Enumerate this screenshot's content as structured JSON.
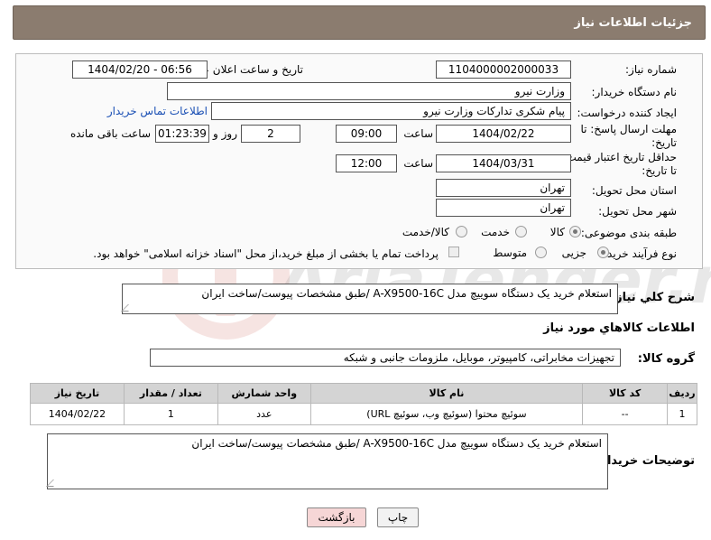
{
  "header": {
    "title": "جزئیات اطلاعات نیاز"
  },
  "form": {
    "need_number_label": "شماره نیاز:",
    "need_number": "1104000002000033",
    "announce_label": "تاریخ و ساعت اعلان عمومی:",
    "announce_value": "1404/02/20 - 06:56",
    "buyer_org_label": "نام دستگاه خریدار:",
    "buyer_org": "وزارت نیرو",
    "requester_label": "ایجاد کننده درخواست:",
    "requester": "پیام شکری تدارکات وزارت نیرو",
    "contact_link": "اطلاعات تماس خریدار",
    "reply_deadline_label": "مهلت ارسال پاسخ: تا تاریخ:",
    "reply_date": "1404/02/22",
    "time_label": "ساعت",
    "reply_time": "09:00",
    "days_value": "2",
    "days_label": "روز و",
    "remaining_time": "01:23:39",
    "remaining_label": "ساعت باقی مانده",
    "validity_label": "حداقل تاریخ اعتبار قیمت: تا تاریخ:",
    "validity_date": "1404/03/31",
    "validity_time": "12:00",
    "province_label": "استان محل تحویل:",
    "province": "تهران",
    "city_label": "شهر محل تحویل:",
    "city": "تهران",
    "category_label": "طبقه بندی موضوعی:",
    "category_options": [
      "کالا",
      "خدمت",
      "کالا/خدمت"
    ],
    "process_label": "نوع فرآیند خرید :",
    "process_options": [
      "جزیی",
      "متوسط"
    ],
    "payment_note": "پرداخت تمام یا بخشی از مبلغ خرید،از محل \"اسناد خزانه اسلامی\" خواهد بود."
  },
  "summary": {
    "label": "شرح کلي نياز:",
    "text": "استعلام خرید یک دستگاه سوییچ مدل A-X9500-16C /طبق مشخصات پیوست/ساخت ایران"
  },
  "goods_section": {
    "title": "اطلاعات کالاهاي مورد نياز",
    "group_label": "گروه کالا:",
    "group_value": "تجهیزات مخابراتی، کامپیوتر، موبایل، ملزومات جانبی و شبکه"
  },
  "table": {
    "headers": [
      "ردیف",
      "کد کالا",
      "نام کالا",
      "واحد شمارش",
      "تعداد / مقدار",
      "تاریخ نیاز"
    ],
    "rows": [
      [
        "1",
        "--",
        "سوئیچ محتوا (سوئیچ وب، سوئیچ URL)",
        "عدد",
        "1",
        "1404/02/22"
      ]
    ]
  },
  "buyer_notes": {
    "label": "توضیحات خریدار:",
    "text": "استعلام خرید یک دستگاه سوییچ مدل A-X9500-16C /طبق مشخصات پیوست/ساخت ایران"
  },
  "buttons": {
    "print": "چاپ",
    "back": "بازگشت"
  },
  "watermark": {
    "text": "AriaTender.net"
  },
  "colors": {
    "header_bg": "#8b7c6f",
    "link": "#1a4fb4",
    "back_button_bg": "#f6d6d6"
  }
}
